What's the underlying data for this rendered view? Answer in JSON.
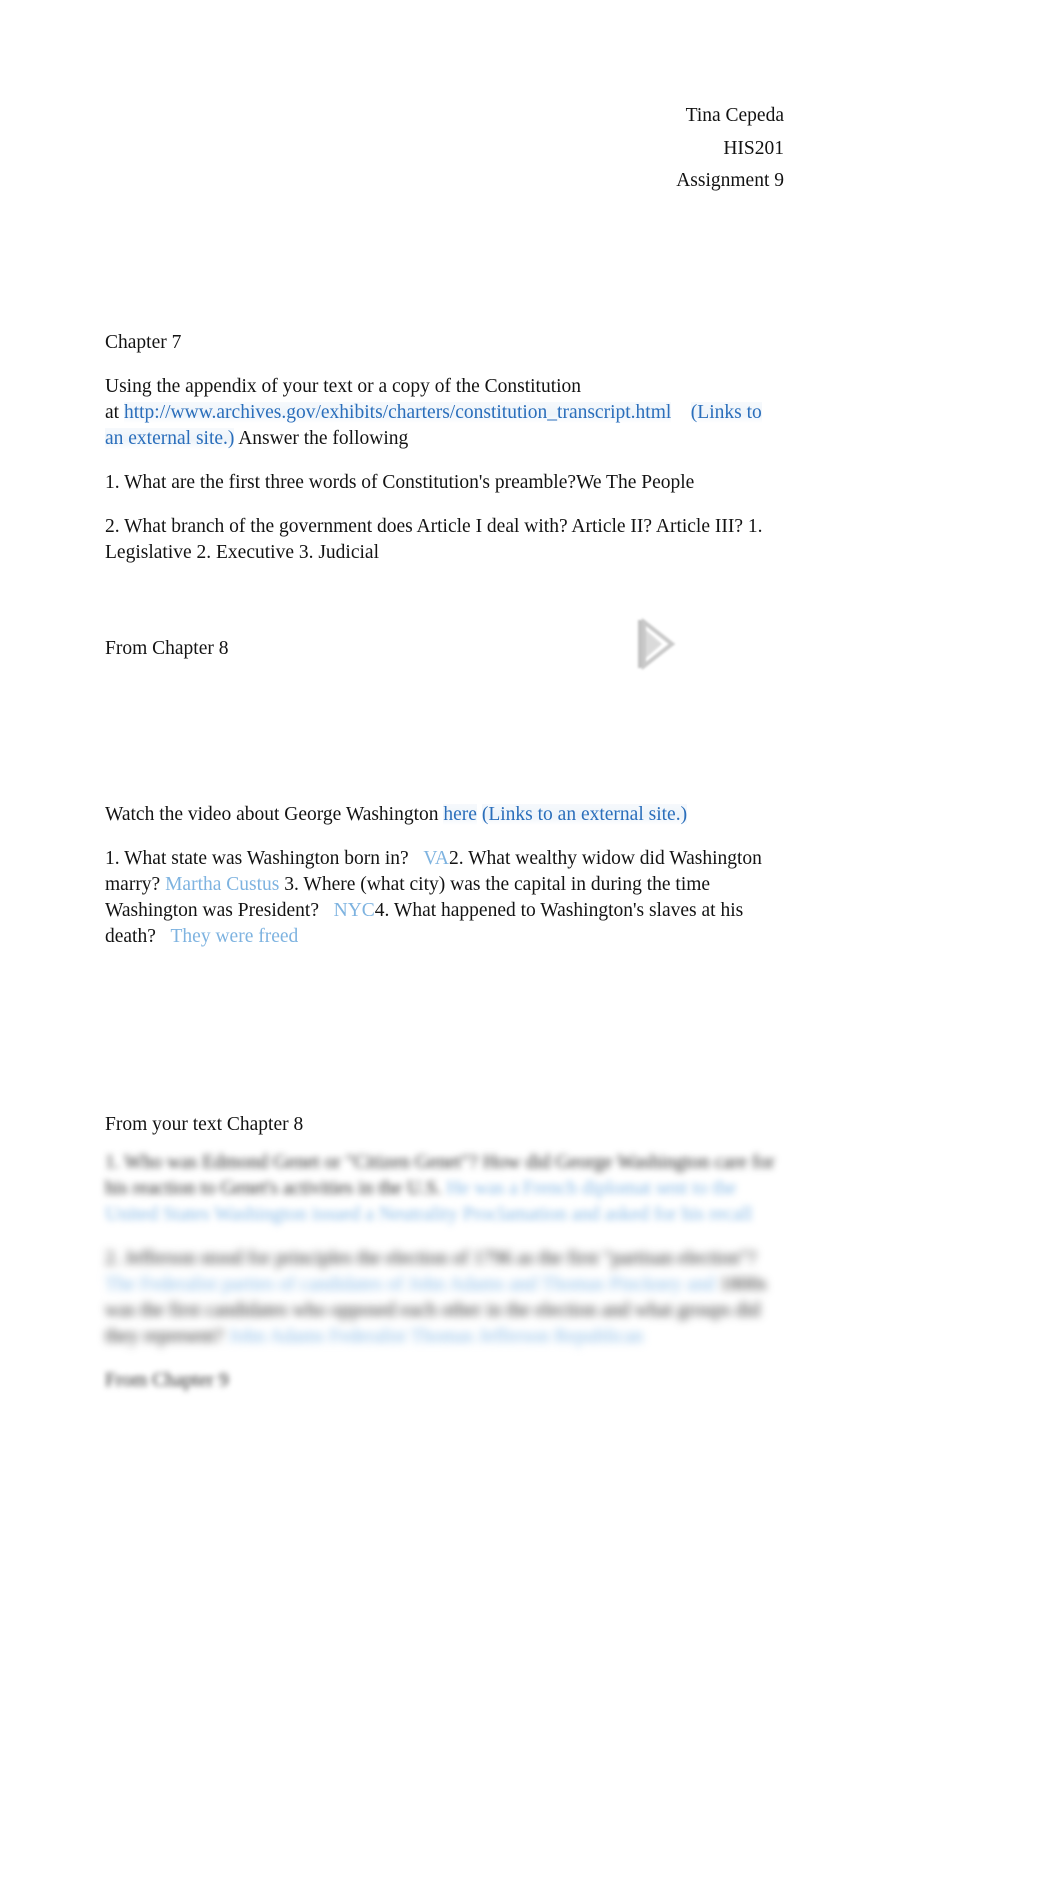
{
  "document": {
    "header": {
      "lines": [
        "Tina Cepeda",
        "HIS201",
        "Assignment 9"
      ]
    },
    "sections": {
      "chapter7_heading": "Chapter 7",
      "instructions": {
        "lead": "Using the appendix of your text or a copy of the Constitution",
        "at_word": "at ",
        "url": "http://www.archives.gov/exhibits/charters/constitution_transcript.html",
        "external_label": "(Links to an external site.)",
        "trailing": " Answer the following"
      },
      "q1": "1. What are the first three words of Constitution's preamble?We The People",
      "q2": "2. What branch of the government does Article I deal with? Article II? Article III? 1. Legislative 2. Executive 3. Judicial",
      "chapter8_heading": "From Chapter 8",
      "video_line": {
        "prefix": "Watch the video about George Washington ",
        "link_word": "here",
        "external_label": "(Links to an external site.)"
      },
      "video_questions": {
        "q1_text": "1. What state was Washington born in?",
        "q1_answer": "VA",
        "q2_text": "2. What wealthy widow did Washington marry?",
        "q2_answer": "Martha Custus",
        "q3_text": "3. Where (what city) was the capital in during the time Washington was President?",
        "q3_answer": "NYC",
        "q4_text": "4. What happened to Washington's slaves at his death?",
        "q4_answer": "They were freed"
      },
      "text_chapter8_heading": "From your text Chapter 8",
      "blurred": {
        "q1": "1. Who was Edmond Genet or \"Citizen Genet\"? How did George Washington care for his reaction to Genet's activities in the U.S.",
        "q1_answer_a": "He was a French diplomat sent to the United States",
        "q1_answer_b": "Washington issued a Neutrality Proclamation and asked for his recall",
        "q2": "2. Jefferson stood for principles the election of 1796 as the first \"partisan election\"?",
        "q2_answer_a": "The Federalist parties of candidates of John Adams and Thomas Pinckney and",
        "q2_answer_b": "1800s was the first candidates who opposed each other in the election and what groups did they represent?",
        "q2_answer_c": "John Adams Federalist Thomas Jefferson Republican",
        "q3": "From Chapter 9"
      }
    },
    "icons": {
      "video_play": "play-icon"
    },
    "colors": {
      "link": "#2a6ebb",
      "answer": "#7eb3e0",
      "text": "#131313",
      "page_background": "#ffffff"
    }
  }
}
